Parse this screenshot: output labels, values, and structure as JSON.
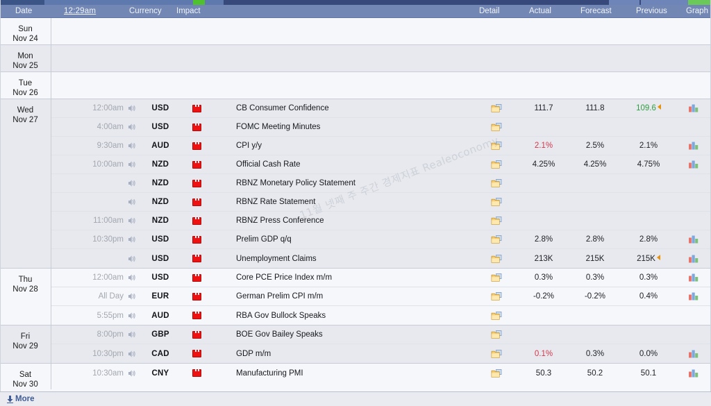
{
  "header": {
    "date": "Date",
    "time": "12:29am",
    "currency": "Currency",
    "impact": "Impact",
    "detail": "Detail",
    "actual": "Actual",
    "forecast": "Forecast",
    "previous": "Previous",
    "graph": "Graph"
  },
  "watermark": "11월 넷째 주 주간 경제지표 Realeoconomy",
  "footer": {
    "more": "More"
  },
  "colors": {
    "header_bg": "#7287b4",
    "row_light": "#f6f7fa",
    "row_dark": "#e7e9ee",
    "impact_high": "#ee1111",
    "value_worse": "#d2384b",
    "value_better": "#2f9e41",
    "arrow": "#e8920c",
    "link": "#3f5b96"
  },
  "days": [
    {
      "dow": "Sun",
      "dom": "Nov 24",
      "shade": "light",
      "events": []
    },
    {
      "dow": "Mon",
      "dom": "Nov 25",
      "shade": "dark",
      "events": []
    },
    {
      "dow": "Tue",
      "dom": "Nov 26",
      "shade": "light",
      "events": []
    },
    {
      "dow": "Wed",
      "dom": "Nov 27",
      "shade": "dark",
      "events": [
        {
          "time": "12:00am",
          "currency": "USD",
          "impact": "high",
          "title": "CB Consumer Confidence",
          "actual": "111.7",
          "actual_state": "neutral",
          "forecast": "111.8",
          "previous": "109.6",
          "previous_state": "better",
          "previous_revised": true,
          "graph": true
        },
        {
          "time": "4:00am",
          "currency": "USD",
          "impact": "high",
          "title": "FOMC Meeting Minutes",
          "actual": "",
          "actual_state": "neutral",
          "forecast": "",
          "previous": "",
          "previous_state": "neutral",
          "previous_revised": false,
          "graph": false
        },
        {
          "time": "9:30am",
          "currency": "AUD",
          "impact": "high",
          "title": "CPI y/y",
          "actual": "2.1%",
          "actual_state": "worse",
          "forecast": "2.5%",
          "previous": "2.1%",
          "previous_state": "neutral",
          "previous_revised": false,
          "graph": true
        },
        {
          "time": "10:00am",
          "currency": "NZD",
          "impact": "high",
          "title": "Official Cash Rate",
          "actual": "4.25%",
          "actual_state": "neutral",
          "forecast": "4.25%",
          "previous": "4.75%",
          "previous_state": "neutral",
          "previous_revised": false,
          "graph": true
        },
        {
          "time": "",
          "currency": "NZD",
          "impact": "high",
          "title": "RBNZ Monetary Policy Statement",
          "actual": "",
          "actual_state": "neutral",
          "forecast": "",
          "previous": "",
          "previous_state": "neutral",
          "previous_revised": false,
          "graph": false
        },
        {
          "time": "",
          "currency": "NZD",
          "impact": "high",
          "title": "RBNZ Rate Statement",
          "actual": "",
          "actual_state": "neutral",
          "forecast": "",
          "previous": "",
          "previous_state": "neutral",
          "previous_revised": false,
          "graph": false
        },
        {
          "time": "11:00am",
          "currency": "NZD",
          "impact": "high",
          "title": "RBNZ Press Conference",
          "actual": "",
          "actual_state": "neutral",
          "forecast": "",
          "previous": "",
          "previous_state": "neutral",
          "previous_revised": false,
          "graph": false
        },
        {
          "time": "10:30pm",
          "currency": "USD",
          "impact": "high",
          "title": "Prelim GDP q/q",
          "actual": "2.8%",
          "actual_state": "neutral",
          "forecast": "2.8%",
          "previous": "2.8%",
          "previous_state": "neutral",
          "previous_revised": false,
          "graph": true
        },
        {
          "time": "",
          "currency": "USD",
          "impact": "high",
          "title": "Unemployment Claims",
          "actual": "213K",
          "actual_state": "neutral",
          "forecast": "215K",
          "previous": "215K",
          "previous_state": "neutral",
          "previous_revised": true,
          "graph": true
        }
      ]
    },
    {
      "dow": "Thu",
      "dom": "Nov 28",
      "shade": "light",
      "events": [
        {
          "time": "12:00am",
          "currency": "USD",
          "impact": "high",
          "title": "Core PCE Price Index m/m",
          "actual": "0.3%",
          "actual_state": "neutral",
          "forecast": "0.3%",
          "previous": "0.3%",
          "previous_state": "neutral",
          "previous_revised": false,
          "graph": true
        },
        {
          "time": "All Day",
          "currency": "EUR",
          "impact": "high",
          "title": "German Prelim CPI m/m",
          "actual": "-0.2%",
          "actual_state": "neutral",
          "forecast": "-0.2%",
          "previous": "0.4%",
          "previous_state": "neutral",
          "previous_revised": false,
          "graph": true
        },
        {
          "time": "5:55pm",
          "currency": "AUD",
          "impact": "high",
          "title": "RBA Gov Bullock Speaks",
          "actual": "",
          "actual_state": "neutral",
          "forecast": "",
          "previous": "",
          "previous_state": "neutral",
          "previous_revised": false,
          "graph": false
        }
      ]
    },
    {
      "dow": "Fri",
      "dom": "Nov 29",
      "shade": "dark",
      "events": [
        {
          "time": "8:00pm",
          "currency": "GBP",
          "impact": "high",
          "title": "BOE Gov Bailey Speaks",
          "actual": "",
          "actual_state": "neutral",
          "forecast": "",
          "previous": "",
          "previous_state": "neutral",
          "previous_revised": false,
          "graph": false
        },
        {
          "time": "10:30pm",
          "currency": "CAD",
          "impact": "high",
          "title": "GDP m/m",
          "actual": "0.1%",
          "actual_state": "worse",
          "forecast": "0.3%",
          "previous": "0.0%",
          "previous_state": "neutral",
          "previous_revised": false,
          "graph": true
        }
      ]
    },
    {
      "dow": "Sat",
      "dom": "Nov 30",
      "shade": "light",
      "events": [
        {
          "time": "10:30am",
          "currency": "CNY",
          "impact": "high",
          "title": "Manufacturing PMI",
          "actual": "50.3",
          "actual_state": "neutral",
          "forecast": "50.2",
          "previous": "50.1",
          "previous_state": "neutral",
          "previous_revised": false,
          "graph": true
        }
      ]
    }
  ],
  "icons": {
    "speaker": "speaker-icon",
    "detail_folder": "folder-icon",
    "graph_bars": "bar-chart-icon",
    "impact_flag": "impact-flag-icon",
    "more_download": "download-arrow-icon"
  }
}
